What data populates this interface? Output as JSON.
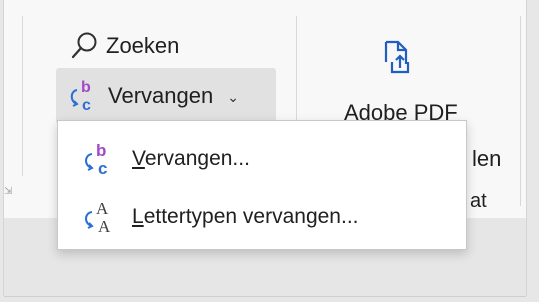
{
  "ribbon": {
    "search_label": "Zoeken",
    "replace_label": "Vervangen",
    "pdf_label": "Adobe PDF",
    "partial_right_1": "len",
    "partial_right_2": "at"
  },
  "menu": {
    "items": [
      {
        "accel": "V",
        "rest": "ervangen..."
      },
      {
        "accel": "L",
        "rest": "ettertypen vervangen..."
      }
    ]
  },
  "colors": {
    "icon_purple": "#a349c8",
    "icon_blue": "#2b6fd6",
    "pdf_blue": "#1f5fbf",
    "hover_bg": "#e1e1e1"
  }
}
